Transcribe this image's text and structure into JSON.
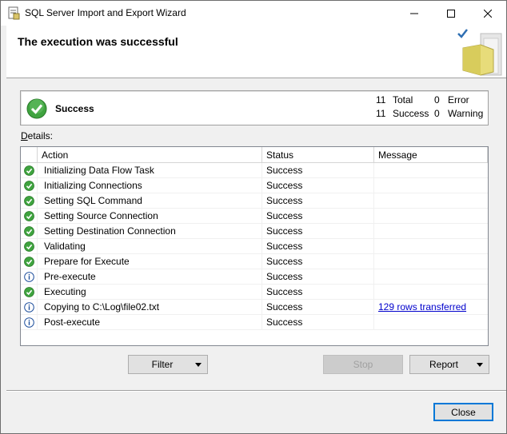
{
  "window": {
    "title": "SQL Server Import and Export Wizard"
  },
  "banner": {
    "title": "The execution was successful"
  },
  "summary": {
    "status_label": "Success",
    "total_count": "11",
    "total_label": "Total",
    "success_count": "11",
    "success_label": "Success",
    "error_count": "0",
    "error_label": "Error",
    "warning_count": "0",
    "warning_label": "Warning"
  },
  "details": {
    "label_prefix": "D",
    "label_rest": "etails:",
    "columns": [
      "Action",
      "Status",
      "Message"
    ],
    "rows": [
      {
        "icon": "success-icon",
        "action": "Initializing Data Flow Task",
        "status": "Success",
        "message": ""
      },
      {
        "icon": "success-icon",
        "action": "Initializing Connections",
        "status": "Success",
        "message": ""
      },
      {
        "icon": "success-icon",
        "action": "Setting SQL Command",
        "status": "Success",
        "message": ""
      },
      {
        "icon": "success-icon",
        "action": "Setting Source Connection",
        "status": "Success",
        "message": ""
      },
      {
        "icon": "success-icon",
        "action": "Setting Destination Connection",
        "status": "Success",
        "message": ""
      },
      {
        "icon": "success-icon",
        "action": "Validating",
        "status": "Success",
        "message": ""
      },
      {
        "icon": "success-icon",
        "action": "Prepare for Execute",
        "status": "Success",
        "message": ""
      },
      {
        "icon": "info-icon",
        "action": "Pre-execute",
        "status": "Success",
        "message": ""
      },
      {
        "icon": "success-icon",
        "action": "Executing",
        "status": "Success",
        "message": ""
      },
      {
        "icon": "info-icon",
        "action": "Copying to C:\\Log\\file02.txt",
        "status": "Success",
        "message": "129 rows transferred"
      },
      {
        "icon": "info-icon",
        "action": "Post-execute",
        "status": "Success",
        "message": ""
      }
    ]
  },
  "buttons": {
    "filter": "Filter",
    "stop": "Stop",
    "report": "Report",
    "close": "Close"
  },
  "colors": {
    "success_green": "#3fa33f",
    "info_blue": "#1e4f9c",
    "link_blue": "#0000cc",
    "accent": "#0078d7"
  }
}
